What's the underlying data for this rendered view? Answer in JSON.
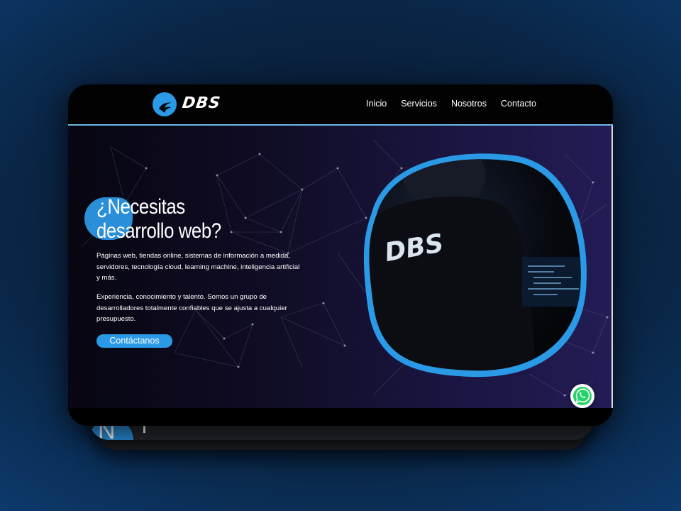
{
  "brand": {
    "logo_text": "DBS",
    "accent_color": "#2a9ae6",
    "icon": "dbs-logo-icon"
  },
  "nav": {
    "items": [
      {
        "label": "Inicio"
      },
      {
        "label": "Servicios"
      },
      {
        "label": "Nosotros"
      },
      {
        "label": "Contacto"
      }
    ]
  },
  "hero": {
    "title_line1": "¿Necesitas",
    "title_line2": "desarrollo web?",
    "paragraph1": "Páginas web, tiendas online, sistemas de información a medida, servidores, tecnología cloud, learning machine, inteligencia artificial y más.",
    "paragraph2": "Experiencia, conocimiento y talento. Somos un grupo de desarrolladores totalmente confiables que se ajusta a cualquier presupuesto.",
    "cta_label": "Contáctanos",
    "photo_shirt_text": "DBS"
  },
  "next_section": {
    "peek_text": "N"
  },
  "floating": {
    "whatsapp_icon": "whatsapp-icon",
    "whatsapp_color": "#25d366"
  }
}
